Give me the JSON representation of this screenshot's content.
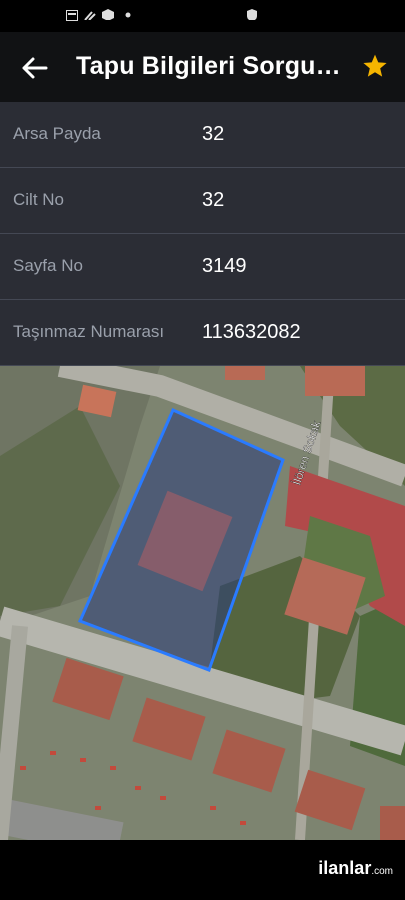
{
  "header": {
    "title": "Tapu Bilgileri Sorgulama"
  },
  "rows": [
    {
      "label": "Arsa Payda",
      "value": "32"
    },
    {
      "label": "Cilt No",
      "value": "32"
    },
    {
      "label": "Sayfa No",
      "value": "3149"
    },
    {
      "label": "Taşınmaz Numarası",
      "value": "113632082"
    }
  ],
  "map": {
    "street_label": "İlören Sokak"
  },
  "footer": {
    "brand": "ilanlar",
    "brand_suffix": ".com"
  },
  "colors": {
    "accent_star": "#f5b400",
    "parcel_outline": "#2a7bff"
  }
}
